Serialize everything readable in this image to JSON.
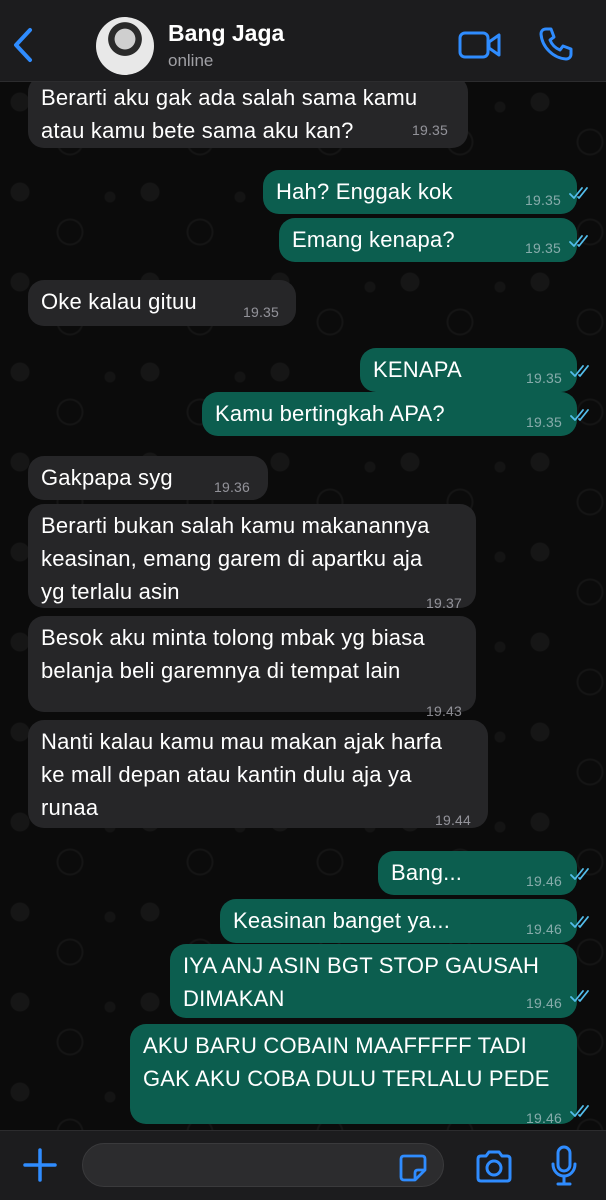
{
  "header": {
    "contact_name": "Bang Jaga",
    "status": "online",
    "back_icon": "chevron-left-icon",
    "video_icon": "video-camera-icon",
    "call_icon": "phone-icon"
  },
  "colors": {
    "accent": "#2f8cff",
    "incoming_bubble": "#262628",
    "outgoing_bubble": "#0c5e4f",
    "read_ticks": "#53bdeb"
  },
  "messages": [
    {
      "dir": "in",
      "lines": [
        "Berarti aku gak ada salah sama kamu",
        "atau kamu bete sama aku kan?"
      ],
      "time": "19.35"
    },
    {
      "dir": "out",
      "lines": [
        "Hah? Enggak kok"
      ],
      "time": "19.35",
      "read": true
    },
    {
      "dir": "out",
      "lines": [
        "Emang kenapa?"
      ],
      "time": "19.35",
      "read": true
    },
    {
      "dir": "in",
      "lines": [
        "Oke kalau gituu"
      ],
      "time": "19.35"
    },
    {
      "dir": "out",
      "lines": [
        "KENAPA"
      ],
      "time": "19.35",
      "read": true
    },
    {
      "dir": "out",
      "lines": [
        "Kamu bertingkah APA?"
      ],
      "time": "19.35",
      "read": true
    },
    {
      "dir": "in",
      "lines": [
        "Gakpapa syg"
      ],
      "time": "19.36"
    },
    {
      "dir": "in",
      "lines": [
        "Berarti bukan salah kamu makanannya",
        "keasinan, emang garem di apartku aja",
        "yg terlalu asin"
      ],
      "time": "19.37"
    },
    {
      "dir": "in",
      "lines": [
        "Besok aku minta tolong mbak yg biasa",
        "belanja beli garemnya di tempat lain"
      ],
      "time": "19.43"
    },
    {
      "dir": "in",
      "lines": [
        "Nanti kalau kamu mau makan ajak harfa",
        "ke mall depan atau kantin dulu aja ya",
        "runaa"
      ],
      "time": "19.44"
    },
    {
      "dir": "out",
      "lines": [
        "Bang..."
      ],
      "time": "19.46",
      "read": true
    },
    {
      "dir": "out",
      "lines": [
        "Keasinan banget ya..."
      ],
      "time": "19.46",
      "read": true
    },
    {
      "dir": "out",
      "lines": [
        "IYA ANJ ASIN BGT STOP GAUSAH",
        "DIMAKAN"
      ],
      "time": "19.46",
      "read": true
    },
    {
      "dir": "out",
      "lines": [
        "AKU BARU COBAIN MAAFFFFF TADI",
        "GAK AKU COBA DULU TERLALU PEDE"
      ],
      "time": "19.46",
      "read": true
    }
  ],
  "input_bar": {
    "placeholder": "",
    "plus_icon": "plus-icon",
    "sticker_icon": "sticker-icon",
    "camera_icon": "camera-icon",
    "mic_icon": "microphone-icon"
  }
}
